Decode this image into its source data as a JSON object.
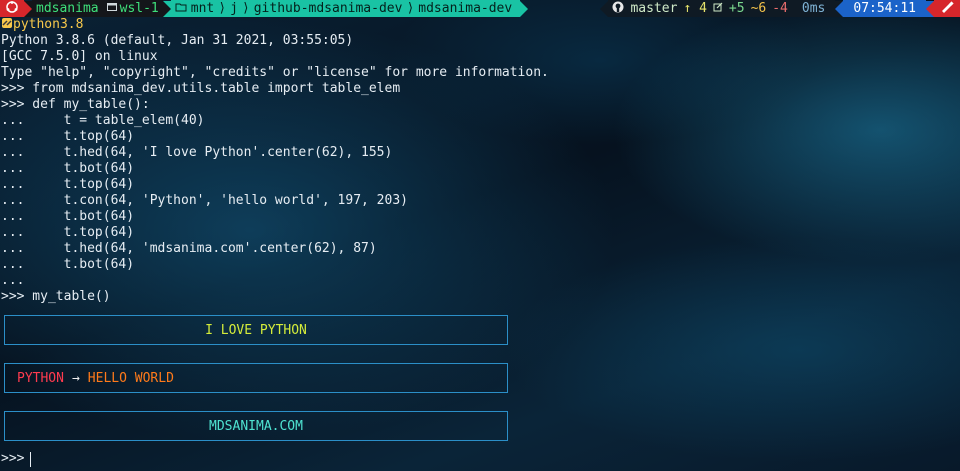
{
  "prompt": {
    "user": "mdsanima",
    "host": "wsl-1",
    "path_parts": [
      "mnt",
      "j",
      "github-mdsanima-dev",
      "mdsanima-dev"
    ],
    "git_branch": "master",
    "git_ahead": "↑ 4",
    "git_added": "+5",
    "git_modified": "~6",
    "git_deleted": "-4",
    "exec_time": "0ms",
    "clock": "07:54:11"
  },
  "terminal": {
    "lines": [
      "python3.8",
      "Python 3.8.6 (default, Jan 31 2021, 03:55:05)",
      "[GCC 7.5.0] on linux",
      "Type \"help\", \"copyright\", \"credits\" or \"license\" for more information.",
      ">>> from mdsanima_dev.utils.table import table_elem",
      ">>> def my_table():",
      "...     t = table_elem(40)",
      "...     t.top(64)",
      "...     t.hed(64, 'I love Python'.center(62), 155)",
      "...     t.bot(64)",
      "...     t.top(64)",
      "...     t.con(64, 'Python', 'hello world', 197, 203)",
      "...     t.bot(64)",
      "...     t.top(64)",
      "...     t.hed(64, 'mdsanima.com'.center(62), 87)",
      "...     t.bot(64)",
      "...",
      ">>> my_table()"
    ],
    "table_1": "I LOVE PYTHON",
    "table_2_left": "PYTHON",
    "table_2_arrow": "→",
    "table_2_right": "HELLO WORLD",
    "table_3": "MDSANIMA.COM",
    "final_prompt": ">>>"
  },
  "colors": {
    "os_segment": "#d6262b",
    "path_segment": "#19c3a4",
    "clock_segment": "#1b63c9",
    "table_border": "#2b8fc8",
    "table_1_text": "#d4ec3a",
    "table_2_left": "#ff3b4f",
    "table_2_right": "#ff7a1a",
    "table_3_text": "#4fe3d1"
  },
  "icons": [
    "ubuntu-icon",
    "terminal-icon",
    "folder-icon",
    "github-icon",
    "edit-icon",
    "battery-icon",
    "python-icon"
  ]
}
